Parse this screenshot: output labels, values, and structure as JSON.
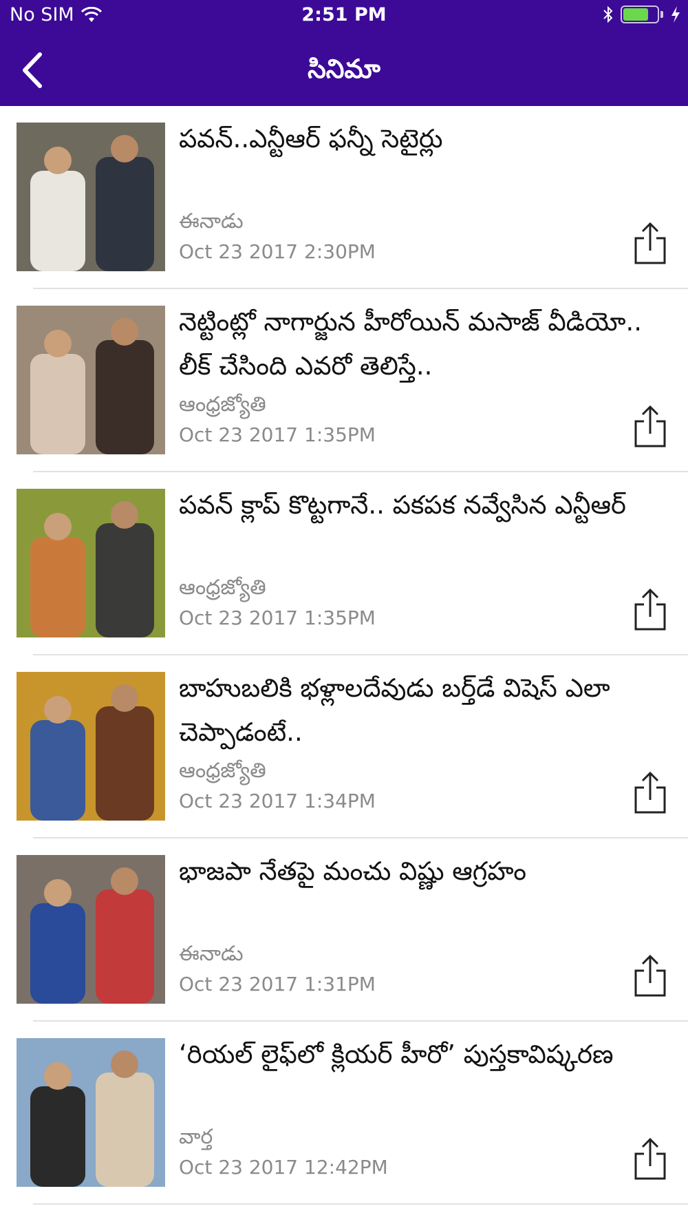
{
  "status_bar": {
    "carrier": "No SIM",
    "time": "2:51 PM",
    "battery_level": 0.75
  },
  "nav": {
    "title": "సినిమా",
    "back_icon": "chevron-left-icon"
  },
  "articles": [
    {
      "title": "పవన్..ఎన్టీఆర్ ఫన్నీ సెటైర్లు",
      "source": "ఈనాడు",
      "date": "Oct 23 2017  2:30PM",
      "thumb_colors": [
        "#6f6a5e",
        "#e9e6df",
        "#2f3540"
      ]
    },
    {
      "title": "నెట్టింట్లో నాగార్జున హీరోయిన్ మసాజ్ వీడియో.. లీక్ చేసింది ఎవరో తెలిస్తే..",
      "source": "ఆంధ్రజ్యోతి",
      "date": "Oct 23 2017  1:35PM",
      "thumb_colors": [
        "#9b8a78",
        "#d9c5b3",
        "#3b2e28"
      ]
    },
    {
      "title": "పవన్ క్లాప్ కొట్టగానే.. పకపక నవ్వేసిన ఎన్టీఆర్",
      "source": "ఆంధ్రజ్యోతి",
      "date": "Oct 23 2017  1:35PM",
      "thumb_colors": [
        "#8a9a3a",
        "#c97a3a",
        "#3a3a38"
      ]
    },
    {
      "title": "బాహుబలికి భళ్లాలదేవుడు బర్త్‌డే విషెస్ ఎలా చెప్పాడంటే..",
      "source": "ఆంధ్రజ్యోతి",
      "date": "Oct 23 2017  1:34PM",
      "thumb_colors": [
        "#c8952c",
        "#3a5a9a",
        "#6b3a22"
      ]
    },
    {
      "title": "భాజపా నేతపై మంచు విష్ణు ఆగ్రహం",
      "source": "ఈనాడు",
      "date": "Oct 23 2017  1:31PM",
      "thumb_colors": [
        "#7a7068",
        "#2a4a9a",
        "#c23a3a"
      ]
    },
    {
      "title": "‘రియల్ లైఫ్‌లో క్లియర్ హీరో’ పుస్తకావిష్కరణ",
      "source": "వార్త",
      "date": "Oct 23 2017 12:42PM",
      "thumb_colors": [
        "#8aa8c8",
        "#2a2a2a",
        "#d8c8b0"
      ]
    }
  ]
}
